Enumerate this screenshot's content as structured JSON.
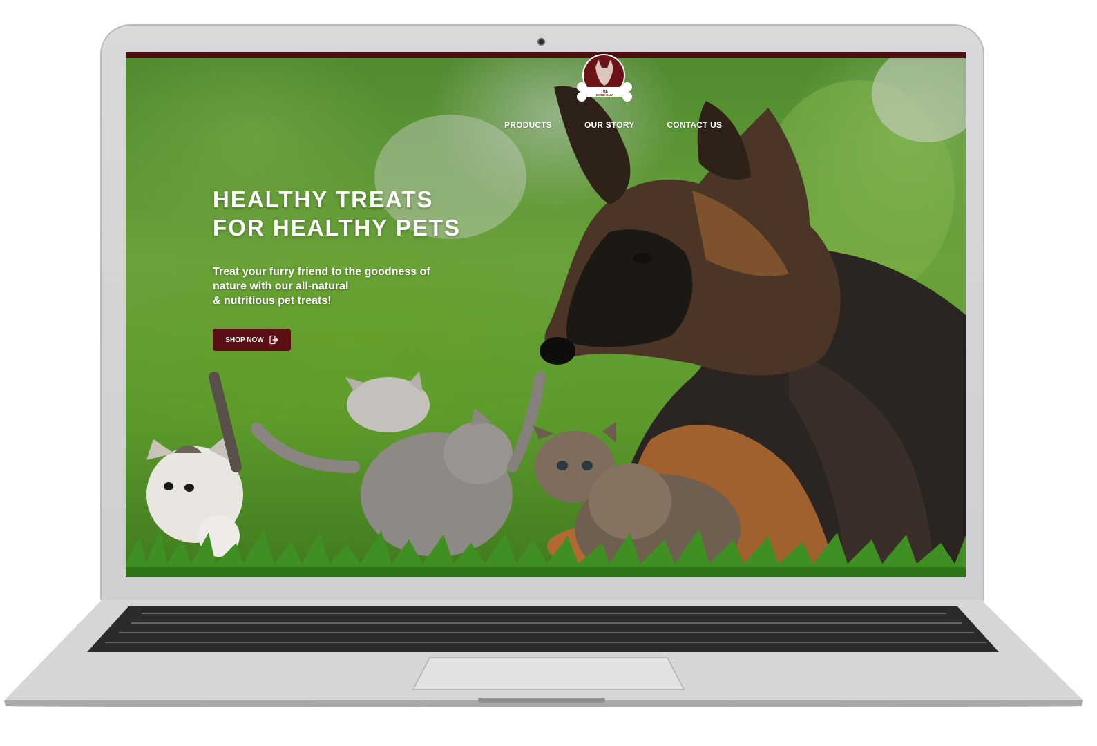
{
  "site": {
    "logo": {
      "icon": "dog-bone-logo-icon",
      "text_line1": "THE",
      "text_line2": "BONE GUY"
    },
    "nav": [
      {
        "label": "PRODUCTS"
      },
      {
        "label": "OUR STORY"
      },
      {
        "label": "CONTACT US"
      }
    ],
    "hero": {
      "headline_line1": "HEALTHY TREATS",
      "headline_line2": "FOR HEALTHY PETS",
      "sub_line1": "Treat your furry friend to the goodness of",
      "sub_line2": "nature with our all-natural",
      "sub_line3": "& nutritious pet treats!",
      "cta_label": "SHOP NOW",
      "cta_icon": "exit-door-icon"
    }
  },
  "colors": {
    "brand": "#5b0f14",
    "topbar": "#4d0f12",
    "text": "#ffffff"
  }
}
